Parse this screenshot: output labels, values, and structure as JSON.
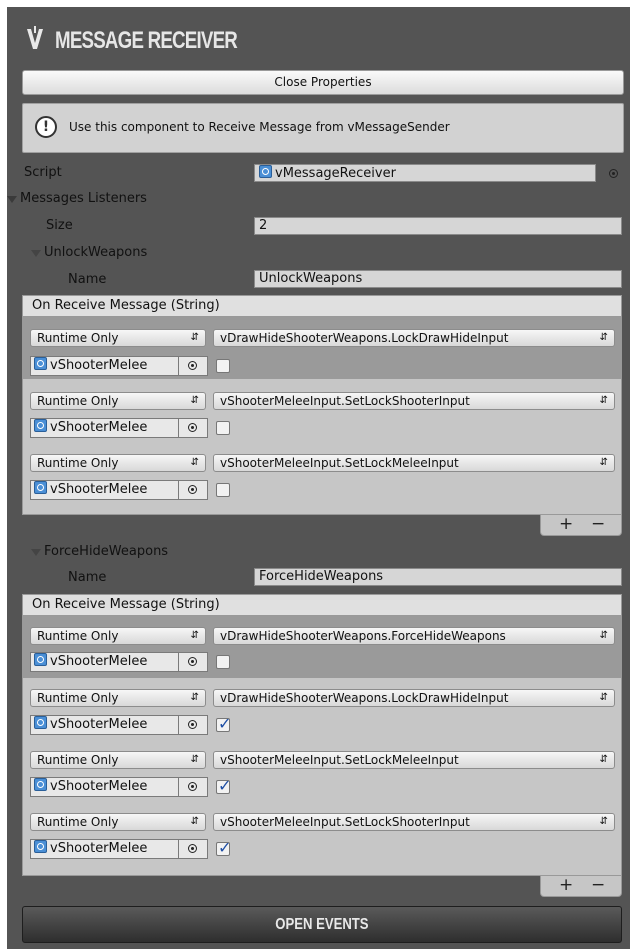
{
  "header": {
    "title": "MESSAGE RECEIVER",
    "logo": "v-logo-icon"
  },
  "close_button": "Close Properties",
  "helpbox": {
    "icon": "info-icon",
    "text": "Use this component to Receive Message from vMessageSender"
  },
  "script": {
    "label": "Script",
    "value": "vMessageReceiver"
  },
  "listeners": {
    "label": "Messages Listeners",
    "size_label": "Size",
    "size_value": "2"
  },
  "elements": [
    {
      "foldout": "UnlockWeapons",
      "name_label": "Name",
      "name_value": "UnlockWeapons",
      "event_header": "On Receive Message (String)",
      "entries": [
        {
          "mode": "Runtime Only",
          "function": "vDrawHideShooterWeapons.LockDrawHideInput",
          "object": "vShooterMelee",
          "checked": false
        },
        {
          "mode": "Runtime Only",
          "function": "vShooterMeleeInput.SetLockShooterInput",
          "object": "vShooterMelee",
          "checked": false
        },
        {
          "mode": "Runtime Only",
          "function": "vShooterMeleeInput.SetLockMeleeInput",
          "object": "vShooterMelee",
          "checked": false
        }
      ]
    },
    {
      "foldout": "ForceHideWeapons",
      "name_label": "Name",
      "name_value": "ForceHideWeapons",
      "event_header": "On Receive Message (String)",
      "entries": [
        {
          "mode": "Runtime Only",
          "function": "vDrawHideShooterWeapons.ForceHideWeapons",
          "object": "vShooterMelee",
          "checked": false
        },
        {
          "mode": "Runtime Only",
          "function": "vDrawHideShooterWeapons.LockDrawHideInput",
          "object": "vShooterMelee",
          "checked": true
        },
        {
          "mode": "Runtime Only",
          "function": "vShooterMeleeInput.SetLockMeleeInput",
          "object": "vShooterMelee",
          "checked": true
        },
        {
          "mode": "Runtime Only",
          "function": "vShooterMeleeInput.SetLockShooterInput",
          "object": "vShooterMelee",
          "checked": true
        }
      ]
    }
  ],
  "list_controls": {
    "add": "+",
    "remove": "−"
  },
  "open_events_button": "OPEN EVENTS"
}
